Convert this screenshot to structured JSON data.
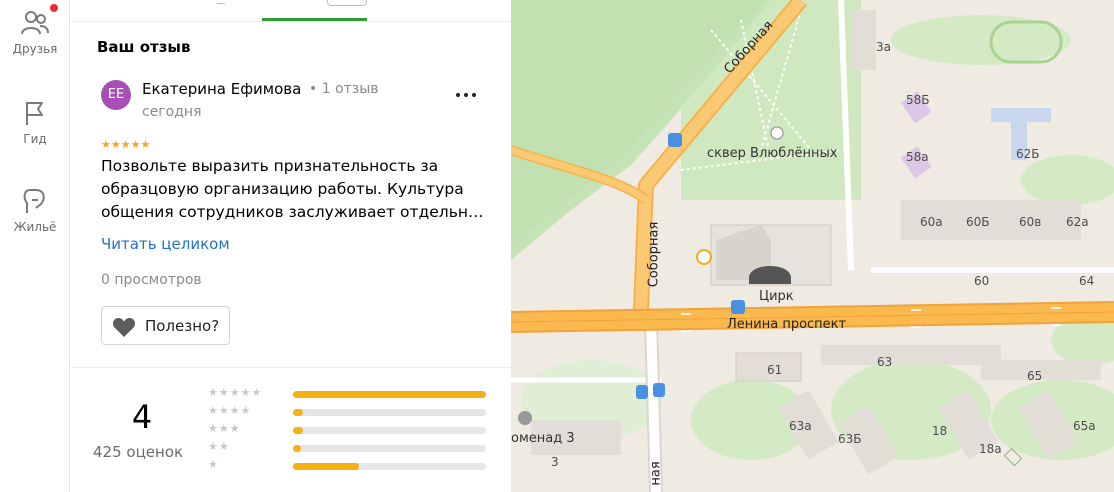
{
  "sidebar": {
    "items": [
      {
        "label": "Друзья",
        "icon": "friends-icon"
      },
      {
        "label": "Гид",
        "icon": "flag-icon"
      },
      {
        "label": "Жильё",
        "icon": "houses-icon"
      }
    ]
  },
  "review": {
    "section_title": "Ваш отзыв",
    "avatar_initials": "ЕЕ",
    "avatar_color": "#a74fb5",
    "author": "Екатерина Ефимова",
    "author_reviews": "1 отзыв",
    "date": "сегодня",
    "stars": "★★★★★",
    "stars_value": 5,
    "text": "Позвольте выразить признательность за образцовую организацию работы. Культура общения сотрудников заслуживает отдельн…",
    "read_more": "Читать целиком",
    "views": "0 просмотров",
    "helpful_label": "Полезно?",
    "more_icon": "dots-icon"
  },
  "rating": {
    "value": "4",
    "count": "425 оценок",
    "distribution": [
      {
        "stars": "★★★★★",
        "fraction": 1.0
      },
      {
        "stars": "★★★★",
        "fraction": 0.05
      },
      {
        "stars": "★★★",
        "fraction": 0.05
      },
      {
        "stars": "★★",
        "fraction": 0.04
      },
      {
        "stars": "★",
        "fraction": 0.34
      }
    ],
    "bar_color": "#f5b014"
  },
  "map": {
    "labels": {
      "street_sobornaya_1": "Соборная",
      "street_sobornaya_2": "Соборная",
      "street_sobornaya_3": "ная",
      "street_lenina": "Ленина проспект",
      "park": "сквер Влюблённых",
      "circus": "Цирк",
      "promenad": "оменад 3",
      "b3a": "3а",
      "b58b": "58Б",
      "b58a": "58а",
      "b62b": "62Б",
      "b60a": "60а",
      "b60b": "60Б",
      "b60v": "60в",
      "b62a": "62а",
      "b60": "60",
      "b64": "64",
      "b63": "63",
      "b61": "61",
      "b65": "65",
      "b63a": "63а",
      "b63b": "63Б",
      "b18": "18",
      "b18a": "18а",
      "b65a": "65а",
      "b3": "3"
    }
  }
}
